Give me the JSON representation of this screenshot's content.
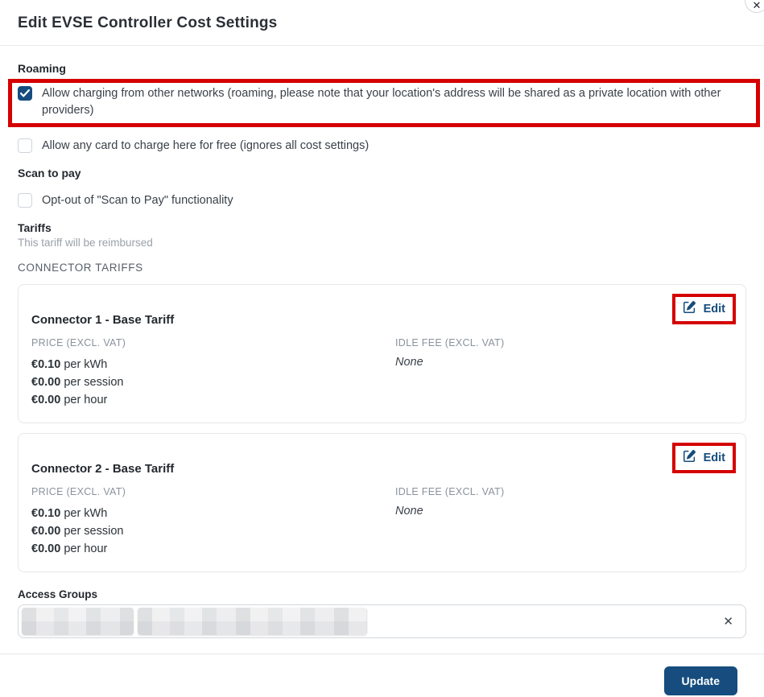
{
  "modal": {
    "title": "Edit EVSE Controller Cost Settings",
    "close_icon": "✕"
  },
  "sections": {
    "roaming": {
      "heading": "Roaming",
      "allow_roaming": {
        "label": "Allow charging from other networks (roaming, please note that your location's address will be shared as a private location with other providers)",
        "checked": true
      },
      "allow_free": {
        "label": "Allow any card to charge here for free (ignores all cost settings)",
        "checked": false
      }
    },
    "scan_to_pay": {
      "heading": "Scan to pay",
      "opt_out": {
        "label": "Opt-out of \"Scan to Pay\" functionality",
        "checked": false
      }
    },
    "tariffs": {
      "heading": "Tariffs",
      "note": "This tariff will be reimbursed",
      "group_label": "CONNECTOR TARIFFS",
      "connectors": [
        {
          "title": "Connector 1 - Base Tariff",
          "edit_label": "Edit",
          "price_label": "PRICE (EXCL. VAT)",
          "prices": [
            {
              "amount": "€0.10",
              "unit": " per kWh"
            },
            {
              "amount": "€0.00",
              "unit": " per session"
            },
            {
              "amount": "€0.00",
              "unit": " per hour"
            }
          ],
          "idle_fee_label": "IDLE FEE (EXCL. VAT)",
          "idle_fee_value": "None"
        },
        {
          "title": "Connector 2 - Base Tariff",
          "edit_label": "Edit",
          "price_label": "PRICE (EXCL. VAT)",
          "prices": [
            {
              "amount": "€0.10",
              "unit": " per kWh"
            },
            {
              "amount": "€0.00",
              "unit": " per session"
            },
            {
              "amount": "€0.00",
              "unit": " per hour"
            }
          ],
          "idle_fee_label": "IDLE FEE (EXCL. VAT)",
          "idle_fee_value": "None"
        }
      ]
    },
    "access_groups": {
      "heading": "Access Groups",
      "value_redacted": true,
      "clear_icon": "✕"
    }
  },
  "footer": {
    "update_label": "Update"
  },
  "colors": {
    "primary_blue": "#164d7e",
    "annotation_red": "#d50000"
  }
}
